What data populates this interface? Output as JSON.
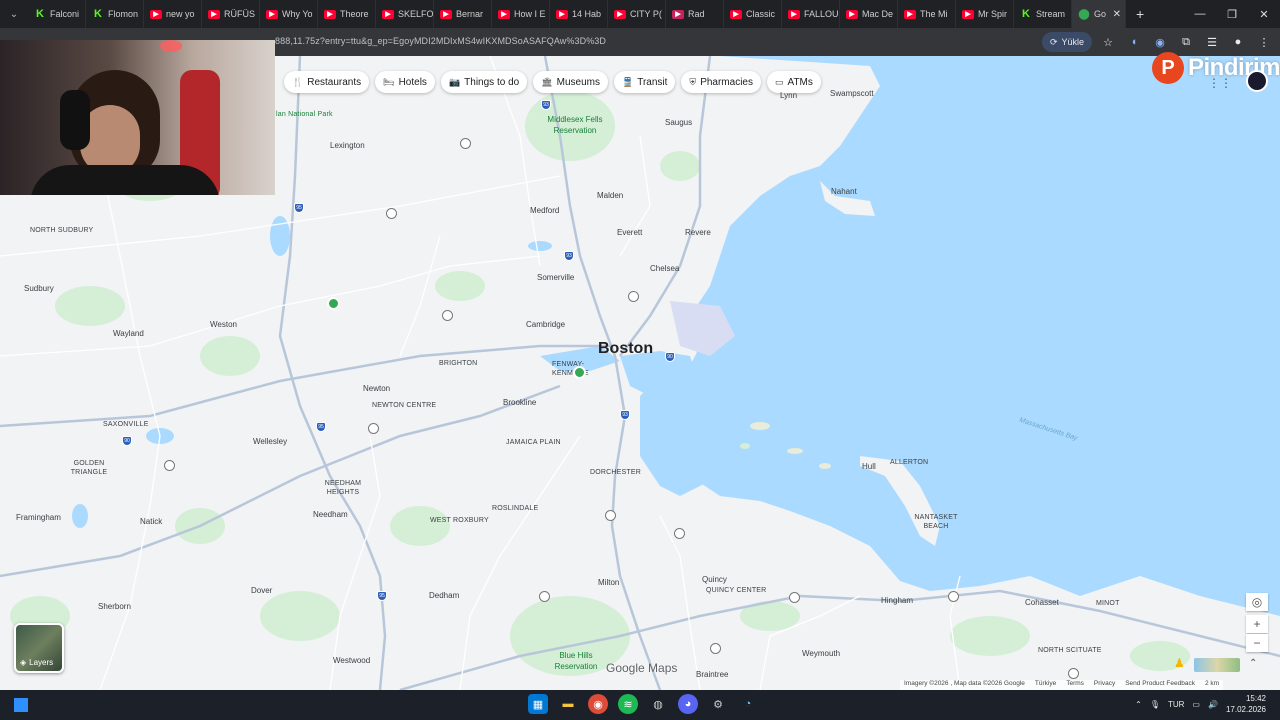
{
  "browser": {
    "tabs": [
      {
        "title": "Falconi",
        "favicon": "kick"
      },
      {
        "title": "Flomon",
        "favicon": "kick"
      },
      {
        "title": "new yo",
        "favicon": "yt"
      },
      {
        "title": "RÜFÜS",
        "favicon": "yt"
      },
      {
        "title": "Why Yo",
        "favicon": "yt"
      },
      {
        "title": "Theore",
        "favicon": "yt"
      },
      {
        "title": "SKELFO",
        "favicon": "yt"
      },
      {
        "title": "Bernar",
        "favicon": "yt"
      },
      {
        "title": "How I E",
        "favicon": "yt"
      },
      {
        "title": "14 Hab",
        "favicon": "yt"
      },
      {
        "title": "CITY P(",
        "favicon": "yt"
      },
      {
        "title": "Rad",
        "favicon": "red"
      },
      {
        "title": "Classic",
        "favicon": "yt"
      },
      {
        "title": "FALLOU",
        "favicon": "yt"
      },
      {
        "title": "Mac De",
        "favicon": "yt"
      },
      {
        "title": "The Mi",
        "favicon": "yt"
      },
      {
        "title": "Mr Spir",
        "favicon": "yt"
      },
      {
        "title": "Stream",
        "favicon": "kick"
      },
      {
        "title": "Go",
        "favicon": "maps",
        "active": true
      }
    ],
    "url": "888,11.75z?entry=ttu&g_ep=EgoyMDI2MDIxMS4wIKXMDSoASAFQAw%3D%3D",
    "update_label": "Yükle"
  },
  "map": {
    "chips": [
      {
        "label": "Restaurants",
        "icon": "fork-knife-icon",
        "glyph": "🍴"
      },
      {
        "label": "Hotels",
        "icon": "bed-icon",
        "glyph": "🛏"
      },
      {
        "label": "Things to do",
        "icon": "camera-icon",
        "glyph": "📷"
      },
      {
        "label": "Museums",
        "icon": "museum-icon",
        "glyph": "🏛"
      },
      {
        "label": "Transit",
        "icon": "train-icon",
        "glyph": "🚆"
      },
      {
        "label": "Pharmacies",
        "icon": "pharmacy-icon",
        "glyph": "⛨"
      },
      {
        "label": "ATMs",
        "icon": "atm-icon",
        "glyph": "▭"
      }
    ],
    "city": "Boston",
    "places": [
      "Lynn",
      "Swampscott",
      "Saugus",
      "Middlesex Fells Reservation",
      "Lexington",
      "Nahant",
      "Malden",
      "Medford",
      "Everett",
      "Revere",
      "NORTH SUDBURY",
      "Chelsea",
      "Somerville",
      "Sudbury",
      "Cambridge",
      "Wayland",
      "Weston",
      "BRIGHTON",
      "Newton",
      "FENWAY-KENMORE",
      "NEWTON CENTRE",
      "Brookline",
      "SAXONVILLE",
      "Wellesley",
      "JAMAICA PLAIN",
      "Hull",
      "ALLERTON",
      "GOLDEN TRIANGLE",
      "DORCHESTER",
      "NEEDHAM HEIGHTS",
      "Needham",
      "Natick",
      "Framingham",
      "WEST ROXBURY",
      "ROSLINDALE",
      "NANTASKET BEACH",
      "Quincy",
      "QUINCY CENTER",
      "Milton",
      "Dover",
      "Dedham",
      "Hingham",
      "Cohasset",
      "MINOT",
      "Sherborn",
      "NORTH SCITUATE",
      "Weymouth",
      "Westwood",
      "Braintree",
      "Blue Hills Reservation",
      "Massachusetts Bay",
      "lan National Park"
    ],
    "brand": "Google Maps",
    "layers_label": "Layers",
    "footer": [
      "Imagery ©2026 , Map data ©2026 Google",
      "Türkiye",
      "Terms",
      "Privacy",
      "Send Product Feedback",
      "2 km"
    ]
  },
  "overlay": {
    "logo_text": "Pindirim",
    "logo_letter": "P"
  },
  "taskbar": {
    "lang": "TUR",
    "time": "15:42",
    "date": "17.02.2026"
  },
  "colors": {
    "water": "#aadaff",
    "land": "#f1f3f4",
    "park": "#d4efd6",
    "road": "#ffffff",
    "highway": "#b8c6d9"
  }
}
